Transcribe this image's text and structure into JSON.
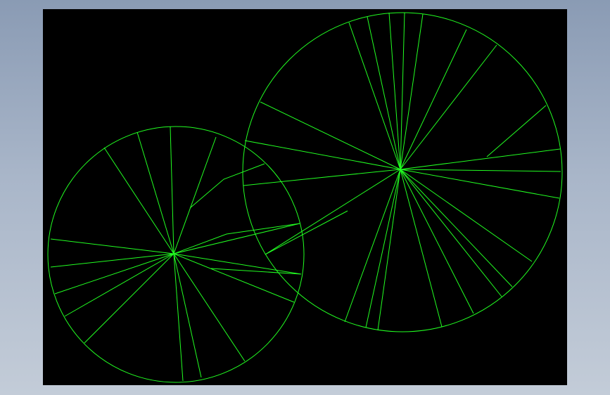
{
  "window": {
    "background_gradient": [
      "#8a9bb4",
      "#c3ccd8"
    ]
  },
  "viewport": {
    "background_color": "#000000"
  },
  "wireframe": {
    "line_color": "#22ff22",
    "shapes": [
      {
        "name": "left-disc",
        "kind": "circle-with-radial-segments"
      },
      {
        "name": "right-disc",
        "kind": "circle-with-radial-segments"
      }
    ]
  }
}
